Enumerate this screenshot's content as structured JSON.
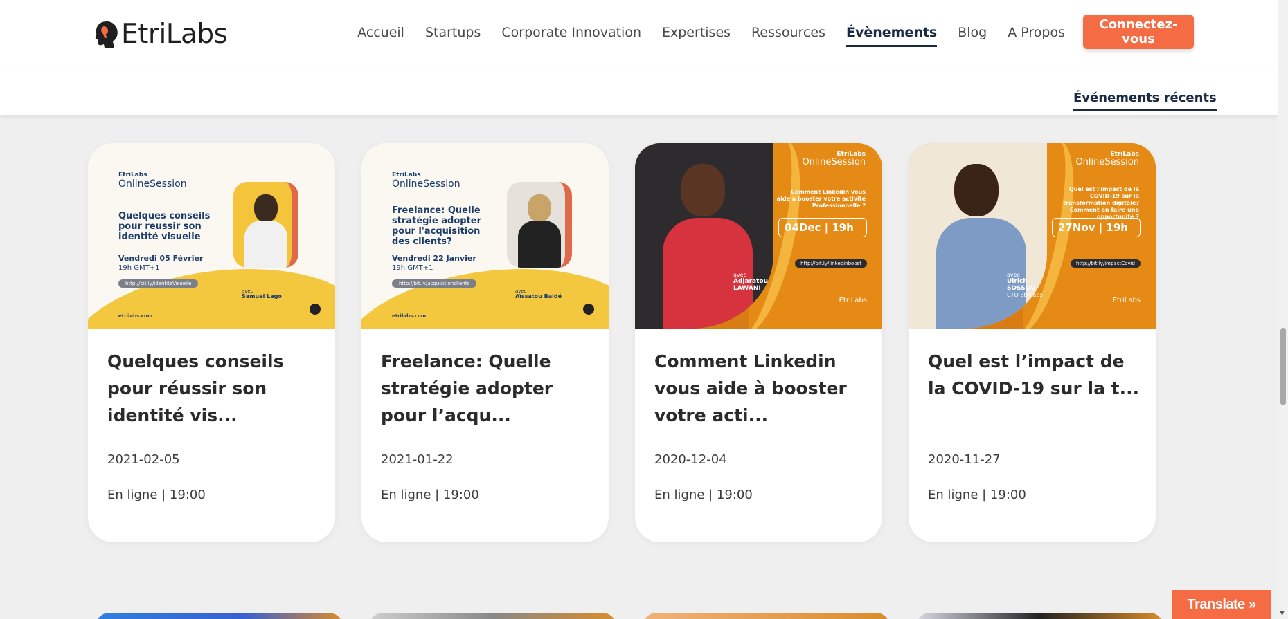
{
  "brand": {
    "name": "EtriLabs"
  },
  "nav": {
    "items": [
      {
        "label": "Accueil",
        "active": false
      },
      {
        "label": "Startups",
        "active": false
      },
      {
        "label": "Corporate Innovation",
        "active": false
      },
      {
        "label": "Expertises",
        "active": false
      },
      {
        "label": "Ressources",
        "active": false
      },
      {
        "label": "Évènements",
        "active": true
      },
      {
        "label": "Blog",
        "active": false
      },
      {
        "label": "A Propos",
        "active": false
      }
    ],
    "cta_label": "Connectez-vous"
  },
  "subnav": {
    "tab_label": "Événements récents"
  },
  "events": [
    {
      "title": "Quelques conseils pour réussir son identité vis...",
      "date": "2021-02-05",
      "location": "En ligne | 19:00",
      "thumb": {
        "style": "light",
        "brand_top": "EtriLabs",
        "brand_bottom": "OnlineSession",
        "headline": "Quelques conseils pour reussir son identité visuelle",
        "day": "Vendredi 05 Février",
        "time": "19h GMT+1",
        "link": "http://bit.ly/identiteVisuelle",
        "speaker_prefix": "avec",
        "speaker": "Samuel Lago",
        "site": "etrilabs.com"
      }
    },
    {
      "title": "Freelance: Quelle stratégie adopter pour l’acqu...",
      "date": "2021-01-22",
      "location": "En ligne | 19:00",
      "thumb": {
        "style": "light",
        "brand_top": "EtriLabs",
        "brand_bottom": "OnlineSession",
        "headline": "Freelance: Quelle stratégie adopter pour l'acquisition des clients?",
        "day": "Vendredi 22 Janvier",
        "time": "19h GMT+1",
        "link": "http://bit.ly/acquisitionclients",
        "speaker_prefix": "avec",
        "speaker": "Aïssatou Baldé",
        "site": "etrilabs.com"
      }
    },
    {
      "title": "Comment Linkedin vous aide à booster votre acti...",
      "date": "2020-12-04",
      "location": "En ligne | 19:00",
      "thumb": {
        "style": "orange",
        "brand_top": "EtriLabs",
        "brand_bottom": "OnlineSession",
        "question": "Comment Linkedin vous aide à booster votre activité Professionnelle ?",
        "date_box": "04Dec | 19h",
        "link": "http://bit.ly/linkedinboost",
        "speaker_prefix": "avec",
        "speaker_line1": "Adjaratou",
        "speaker_line2": "LAWANI",
        "logo": "EtriLabs"
      }
    },
    {
      "title": "Quel est l’impact de la COVID-19 sur la t...",
      "date": "2020-11-27",
      "location": "En ligne | 19:00",
      "thumb": {
        "style": "orange",
        "brand_top": "EtriLabs",
        "brand_bottom": "OnlineSession",
        "question": "Quel est l'impact de la COVID-19 sur la transformation digitale? Comment en faire une opportunité ?",
        "date_box": "27Nov | 19h",
        "link": "http://bit.ly/impactCovid",
        "speaker_prefix": "avec",
        "speaker_line1": "Ulrich",
        "speaker_line2": "SOSSOU",
        "speaker_role": "CTO EtriLabs",
        "logo": "EtriLabs"
      }
    }
  ],
  "translate": {
    "label": "Translate »"
  },
  "colors": {
    "accent": "#f56b43",
    "navy": "#1a2a44",
    "thumb_yellow": "#f3c73e",
    "thumb_orange": "#e58a14"
  }
}
